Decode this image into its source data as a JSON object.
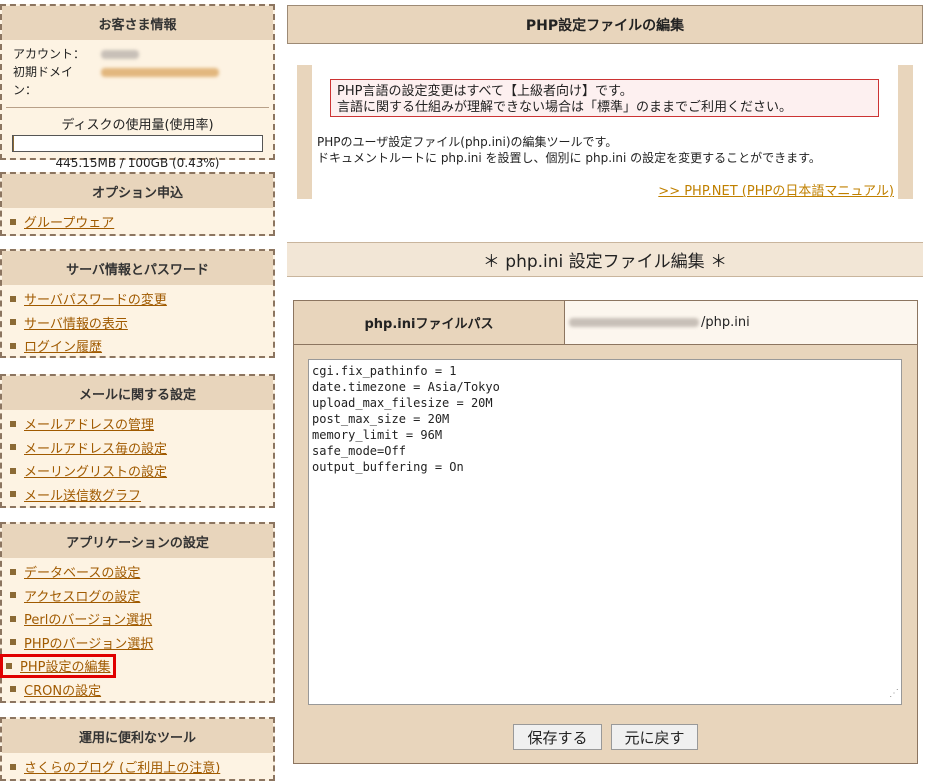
{
  "sidebar": {
    "customer": {
      "title": "お客さま情報",
      "account_label": "アカウント：",
      "domain_label": "初期ドメイン：",
      "disk_title": "ディスクの使用量(使用率)",
      "disk_usage": "445.15MB / 100GB (0.43%)",
      "disk_percent": 0.43
    },
    "option": {
      "title": "オプション申込",
      "items": [
        "グループウェア"
      ]
    },
    "server": {
      "title": "サーバ情報とパスワード",
      "items": [
        "サーバパスワードの変更",
        "サーバ情報の表示",
        "ログイン履歴"
      ]
    },
    "mail": {
      "title": "メールに関する設定",
      "items": [
        "メールアドレスの管理",
        "メールアドレス毎の設定",
        "メーリングリストの設定",
        "メール送信数グラフ"
      ]
    },
    "app": {
      "title": "アプリケーションの設定",
      "items": [
        "データベースの設定",
        "アクセスログの設定",
        "Perlのバージョン選択",
        "PHPのバージョン選択",
        "PHP設定の編集",
        "CRONの設定"
      ]
    },
    "tools": {
      "title": "運用に便利なツール",
      "items": [
        "さくらのブログ (ご利用上の注意)"
      ]
    }
  },
  "main": {
    "page_title": "PHP設定ファイルの編集",
    "warning_line1": "PHP言語の設定変更はすべて【上級者向け】です。",
    "warning_line2": "言語に関する仕組みが理解できない場合は「標準」のままでご利用ください。",
    "desc_line1": "PHPのユーザ設定ファイル(php.ini)の編集ツールです。",
    "desc_line2": "ドキュメントルートに php.ini を設置し、個別に php.ini の設定を変更することができます。",
    "php_link": ">> PHP.NET (PHPの日本語マニュアル)",
    "section_title": "＊ php.ini 設定ファイル編集 ＊",
    "path_label": "php.iniファイルパス",
    "path_suffix": "/php.ini",
    "code_lines": [
      "cgi.fix_pathinfo = 1",
      "date.timezone = Asia/Tokyo",
      "upload_max_filesize = 20M",
      "post_max_size = 20M",
      "memory_limit = 96M",
      "safe_mode=Off",
      "output_buffering = On"
    ],
    "save_button": "保存する",
    "revert_button": "元に戻す"
  }
}
